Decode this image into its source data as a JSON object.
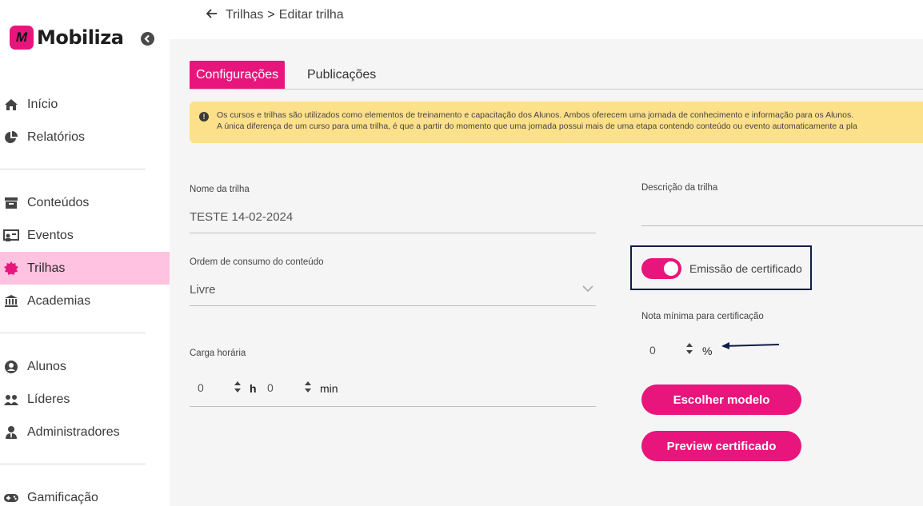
{
  "app": {
    "brand": "Mobiliza",
    "brand_mark": "M",
    "brand_color": "#e8157d",
    "collapse_icon": "chevron-left-icon"
  },
  "sidebar": {
    "items": [
      {
        "label": "Início",
        "icon": "home-icon"
      },
      {
        "label": "Relatórios",
        "icon": "pie-chart-icon"
      },
      {
        "label": "Conteúdos",
        "icon": "archive-icon"
      },
      {
        "label": "Eventos",
        "icon": "presentation-icon"
      },
      {
        "label": "Trilhas",
        "icon": "badge-icon",
        "active": true
      },
      {
        "label": "Academias",
        "icon": "institution-icon"
      },
      {
        "label": "Alunos",
        "icon": "user-circle-icon"
      },
      {
        "label": "Líderes",
        "icon": "users-icon"
      },
      {
        "label": "Administradores",
        "icon": "user-tie-icon"
      },
      {
        "label": "Gamificação",
        "icon": "gamepad-icon"
      }
    ]
  },
  "breadcrumb": {
    "parent": "Trilhas",
    "separator": ">",
    "current": "Editar trilha"
  },
  "tabs": [
    {
      "label": "Configurações",
      "active": true
    },
    {
      "label": "Publicações",
      "active": false
    }
  ],
  "alert": {
    "line1": "Os cursos e trilhas são utilizados como elementos de treinamento e capacitação dos Alunos. Ambos oferecem uma jornada de conhecimento e informação para os Alunos.",
    "line2": "A única diferença de um curso para uma trilha, é que a partir do momento que uma jornada possui mais de uma etapa contendo conteúdo ou evento automaticamente a pla"
  },
  "form": {
    "name_label": "Nome da trilha",
    "name_value": "TESTE 14-02-2024",
    "order_label": "Ordem de consumo do conteúdo",
    "order_value": "Livre",
    "workload_label": "Carga horária",
    "hours_value": "0",
    "hours_unit": "h",
    "minutes_value": "0",
    "minutes_unit": "min",
    "description_label": "Descrição da trilha",
    "certificate_toggle_label": "Emissão de certificado",
    "certificate_enabled": true,
    "min_grade_label": "Nota mínima para certificação",
    "min_grade_value": "0",
    "min_grade_unit": "%",
    "choose_template_button": "Escolher modelo",
    "preview_certificate_button": "Preview certificado"
  }
}
